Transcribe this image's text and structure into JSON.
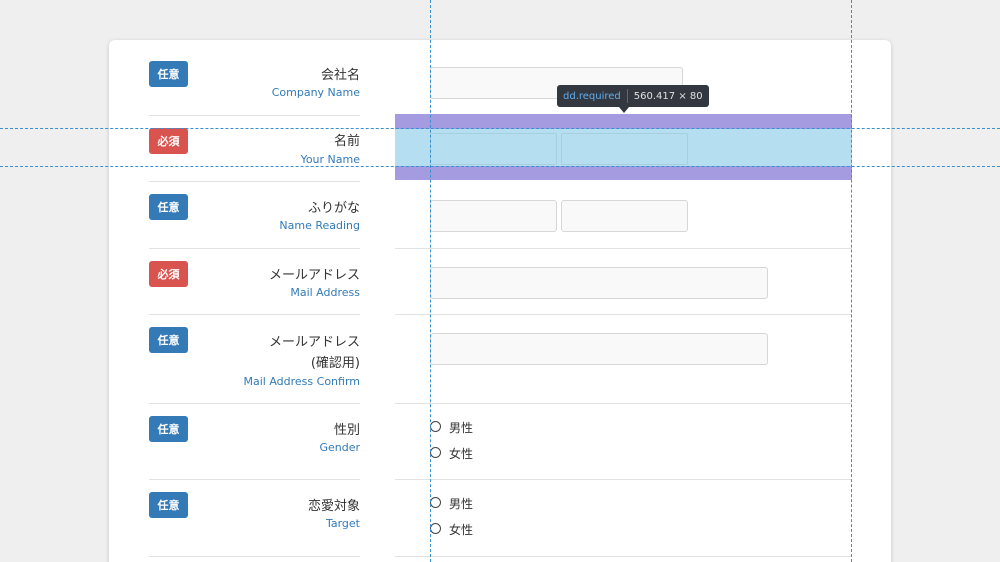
{
  "tooltip": {
    "selector": "dd.required",
    "size": "560.417 × 80"
  },
  "rows": {
    "company": {
      "badge": "任意",
      "jp": "会社名",
      "en": "Company Name"
    },
    "name": {
      "badge": "必須",
      "jp": "名前",
      "en": "Your Name"
    },
    "reading": {
      "badge": "任意",
      "jp": "ふりがな",
      "en": "Name Reading"
    },
    "mail": {
      "badge": "必須",
      "jp": "メールアドレス",
      "en": "Mail Address"
    },
    "mailconfirm": {
      "badge": "任意",
      "jp": "メールアドレス",
      "jp2": "(確認用)",
      "en": "Mail Address Confirm"
    },
    "gender": {
      "badge": "任意",
      "jp": "性別",
      "en": "Gender",
      "options": [
        "男性",
        "女性"
      ]
    },
    "target": {
      "badge": "任意",
      "jp": "恋愛対象",
      "en": "Target",
      "options": [
        "男性",
        "女性"
      ]
    }
  },
  "colors": {
    "optional_badge": "#337ab7",
    "required_badge": "#d9534f",
    "highlight_margin": "#a59be0",
    "highlight_content": "#b5dff0"
  }
}
